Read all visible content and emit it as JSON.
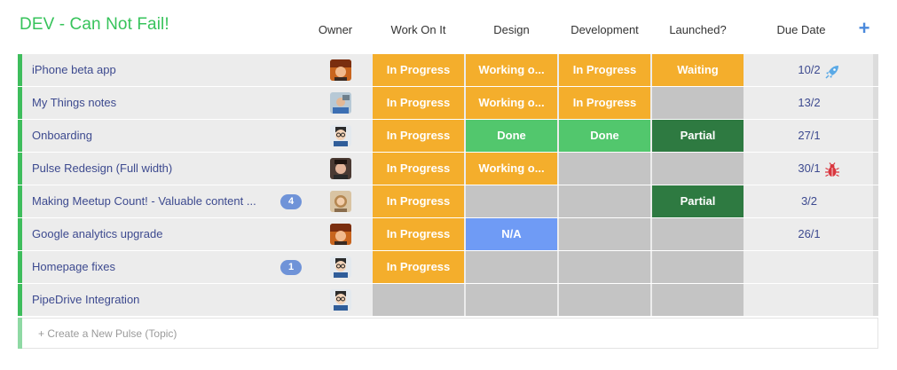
{
  "board": {
    "title": "DEV - Can Not Fail!",
    "columns": {
      "owner": "Owner",
      "work_on_it": "Work On It",
      "design": "Design",
      "development": "Development",
      "launched": "Launched?",
      "due_date": "Due Date",
      "add_column": "+"
    },
    "rows": [
      {
        "name": "iPhone beta app",
        "badge": "",
        "avatar": "avatar-orange",
        "work": {
          "label": "In Progress",
          "status": "progress"
        },
        "design": {
          "label": "Working o...",
          "status": "working"
        },
        "development": {
          "label": "In Progress",
          "status": "progress"
        },
        "launched": {
          "label": "Waiting",
          "status": "waiting"
        },
        "due": "10/2",
        "due_icon": "rocket-icon"
      },
      {
        "name": "My Things notes",
        "badge": "",
        "avatar": "avatar-blue",
        "work": {
          "label": "In Progress",
          "status": "progress"
        },
        "design": {
          "label": "Working o...",
          "status": "working"
        },
        "development": {
          "label": "In Progress",
          "status": "progress"
        },
        "launched": {
          "label": "",
          "status": "empty"
        },
        "due": "13/2",
        "due_icon": ""
      },
      {
        "name": "Onboarding",
        "badge": "",
        "avatar": "avatar-glasses",
        "work": {
          "label": "In Progress",
          "status": "progress"
        },
        "design": {
          "label": "Done",
          "status": "done"
        },
        "development": {
          "label": "Done",
          "status": "done"
        },
        "launched": {
          "label": "Partial",
          "status": "partial"
        },
        "due": "27/1",
        "due_icon": ""
      },
      {
        "name": "Pulse Redesign (Full width)",
        "badge": "",
        "avatar": "avatar-dark",
        "work": {
          "label": "In Progress",
          "status": "progress"
        },
        "design": {
          "label": "Working o...",
          "status": "working"
        },
        "development": {
          "label": "",
          "status": "empty"
        },
        "launched": {
          "label": "",
          "status": "empty"
        },
        "due": "30/1",
        "due_icon": "bug-icon"
      },
      {
        "name": "Making Meetup Count! - Valuable content ...",
        "badge": "4",
        "avatar": "avatar-woman",
        "work": {
          "label": "In Progress",
          "status": "progress"
        },
        "design": {
          "label": "",
          "status": "empty"
        },
        "development": {
          "label": "",
          "status": "empty"
        },
        "launched": {
          "label": "Partial",
          "status": "partial"
        },
        "due": "3/2",
        "due_icon": ""
      },
      {
        "name": "Google analytics upgrade",
        "badge": "",
        "avatar": "avatar-orange",
        "work": {
          "label": "In Progress",
          "status": "progress"
        },
        "design": {
          "label": "N/A",
          "status": "na"
        },
        "development": {
          "label": "",
          "status": "empty"
        },
        "launched": {
          "label": "",
          "status": "empty"
        },
        "due": "26/1",
        "due_icon": ""
      },
      {
        "name": "Homepage fixes",
        "badge": "1",
        "avatar": "avatar-glasses",
        "work": {
          "label": "In Progress",
          "status": "progress"
        },
        "design": {
          "label": "",
          "status": "empty"
        },
        "development": {
          "label": "",
          "status": "empty"
        },
        "launched": {
          "label": "",
          "status": "empty"
        },
        "due": "",
        "due_icon": ""
      },
      {
        "name": "PipeDrive Integration",
        "badge": "",
        "avatar": "avatar-glasses",
        "work": {
          "label": "",
          "status": "empty"
        },
        "design": {
          "label": "",
          "status": "empty"
        },
        "development": {
          "label": "",
          "status": "empty"
        },
        "launched": {
          "label": "",
          "status": "empty"
        },
        "due": "",
        "due_icon": ""
      }
    ],
    "new_pulse_placeholder": "+ Create a New Pulse (Topic)"
  },
  "colors": {
    "title_green": "#37c35b",
    "in_progress": "#f4ae2c",
    "done": "#52c76d",
    "partial": "#2e7a41",
    "na": "#6f9bf5",
    "empty": "#c4c4c4",
    "row_accent": "#3ebd5c",
    "link_text": "#3d4a8f"
  }
}
